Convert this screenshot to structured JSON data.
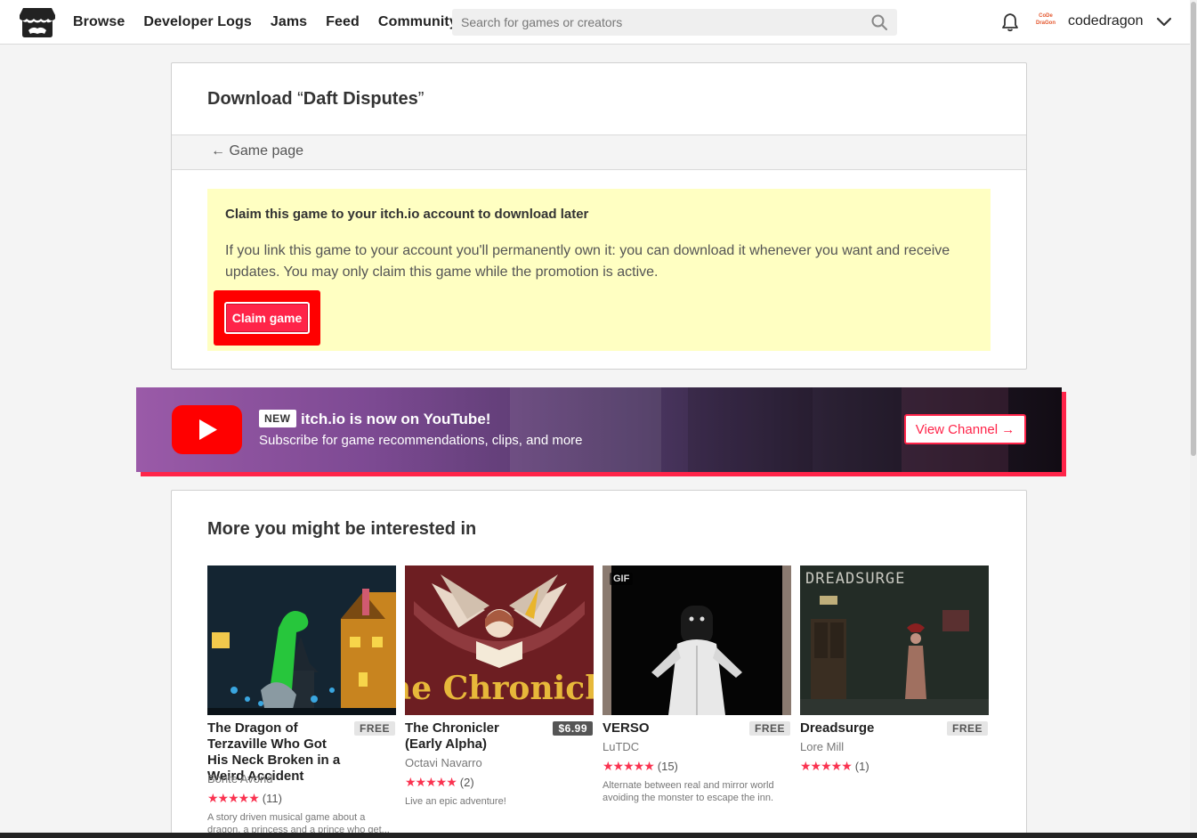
{
  "header": {
    "nav": [
      "Browse",
      "Developer Logs",
      "Jams",
      "Feed",
      "Community"
    ],
    "search_placeholder": "Search for games or creators",
    "username": "codedragon",
    "avatar_text": "CoDe DraGon"
  },
  "download": {
    "title_prefix": "Download",
    "title_quote_open": "“",
    "game_name": "Daft Disputes",
    "title_quote_close": "”",
    "back_arrow": "←",
    "back_label": "Game page",
    "claim_title": "Claim this game to your itch.io account to download later",
    "claim_description": "If you link this game to your account you'll permanently own it: you can download it whenever you want and receive updates. You may only claim this game while the promotion is active.",
    "claim_button": "Claim game"
  },
  "youtube_banner": {
    "badge": "NEW",
    "title": "itch.io is now on YouTube!",
    "subtitle": "Subscribe for game recommendations, clips, and more",
    "button": "View Channel →"
  },
  "recommendations": {
    "title": "More you might be interested in",
    "games": [
      {
        "title": "The Dragon of Terzaville Who Got His Neck Broken in a Weird Accident",
        "price": "FREE",
        "author": "Bonte Avond",
        "stars": "★★★★★",
        "rating_count": "(11)",
        "description": "A story driven musical game about a dragon, a princess and a prince who get..."
      },
      {
        "title": "The Chronicler (Early Alpha)",
        "price": "$6.99",
        "author": "Octavi Navarro",
        "stars": "★★★★★",
        "rating_count": "(2)",
        "description": "Live an epic adventure!",
        "art_text": "The Chronicler"
      },
      {
        "title": "VERSO",
        "price": "FREE",
        "author": "LuTDC",
        "stars": "★★★★★",
        "rating_count": "(15)",
        "description": "Alternate between real and mirror world avoiding the monster to escape the inn.",
        "badge": "GIF"
      },
      {
        "title": "Dreadsurge",
        "price": "FREE",
        "author": "Lore Mill",
        "stars": "★★★★★",
        "rating_count": "(1)",
        "description": "",
        "art_text": "DREADSURGE"
      }
    ]
  },
  "colors": {
    "accent": "#ff2449",
    "claim_bg": "#ffffc2",
    "highlight": "#ff0000",
    "star": "#fa3350"
  }
}
